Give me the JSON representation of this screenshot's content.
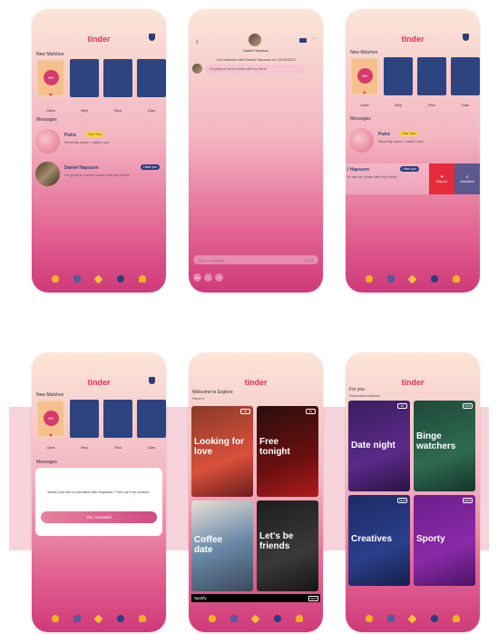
{
  "app": {
    "logo": "tinder"
  },
  "matches_screen": {
    "new_matches_label": "New Matches",
    "likes_count": "99+",
    "likes_label": "Likes",
    "match_names": [
      "Mey",
      "Rico",
      "Gam"
    ],
    "messages_label": "Messages",
    "messages": [
      {
        "name": "Putra",
        "tag": "Your Turn",
        "preview": "Recently active, match now!"
      },
      {
        "name": "Daniel Hapsson",
        "tag": "Liked you",
        "preview": "I'm going to eat ice cream with my friend"
      }
    ]
  },
  "chat_screen": {
    "contact_name": "Daniel Hapsson",
    "matched_text": "You matched with Daniel Hapsson on 12/18/2022",
    "bubble_text": "I'm going to eat ice cream with my friend",
    "input_placeholder": "Type a message",
    "send_label": "Send",
    "tools": [
      "GIF",
      "♪",
      "≋"
    ]
  },
  "unmatch_swipe_screen": {
    "match_names": [
      "Mey",
      "Rico",
      "Gam"
    ],
    "row_name": "l Hapsson",
    "row_tag": "Liked you",
    "row_preview": "to eat ice cream with my friend",
    "report_label": "Report",
    "unmatch_label": "Unmatch"
  },
  "unmatch_dialog_screen": {
    "match_names": [
      "Mey",
      "Rico",
      "Gam"
    ],
    "dialog_text": "Would you like to unmatch with Hapsson? This can't be undone.",
    "confirm_label": "Yes, Unmatch"
  },
  "explore_screen": {
    "title": "Welcome to Explore",
    "subtitle": "Recent",
    "tiles": [
      {
        "label": "Looking for love",
        "badge": "5d"
      },
      {
        "label": "Free tonight",
        "badge": "5d"
      },
      {
        "label": "Coffee date",
        "badge": ""
      },
      {
        "label": "Let's be friends",
        "badge": ""
      }
    ],
    "spotify_label": "Spotify",
    "spotify_badge": "NEW"
  },
  "explore_recs_screen": {
    "title": "For you",
    "subtitle": "Recommendations",
    "tiles": [
      {
        "label": "Date night",
        "badge": "5d"
      },
      {
        "label": "Binge watchers",
        "badge": "NEW"
      },
      {
        "label": "Creatives",
        "badge": "NEW"
      },
      {
        "label": "Sporty",
        "badge": "NEW"
      }
    ]
  },
  "colors": {
    "brand": "#e0325f",
    "navy": "#2d3e7a",
    "report": "#e62a3c",
    "unmatch": "#5d578f"
  },
  "tab_icons": [
    "flame-icon",
    "grid-icon",
    "sparkle-icon",
    "chat-icon",
    "profile-icon"
  ]
}
